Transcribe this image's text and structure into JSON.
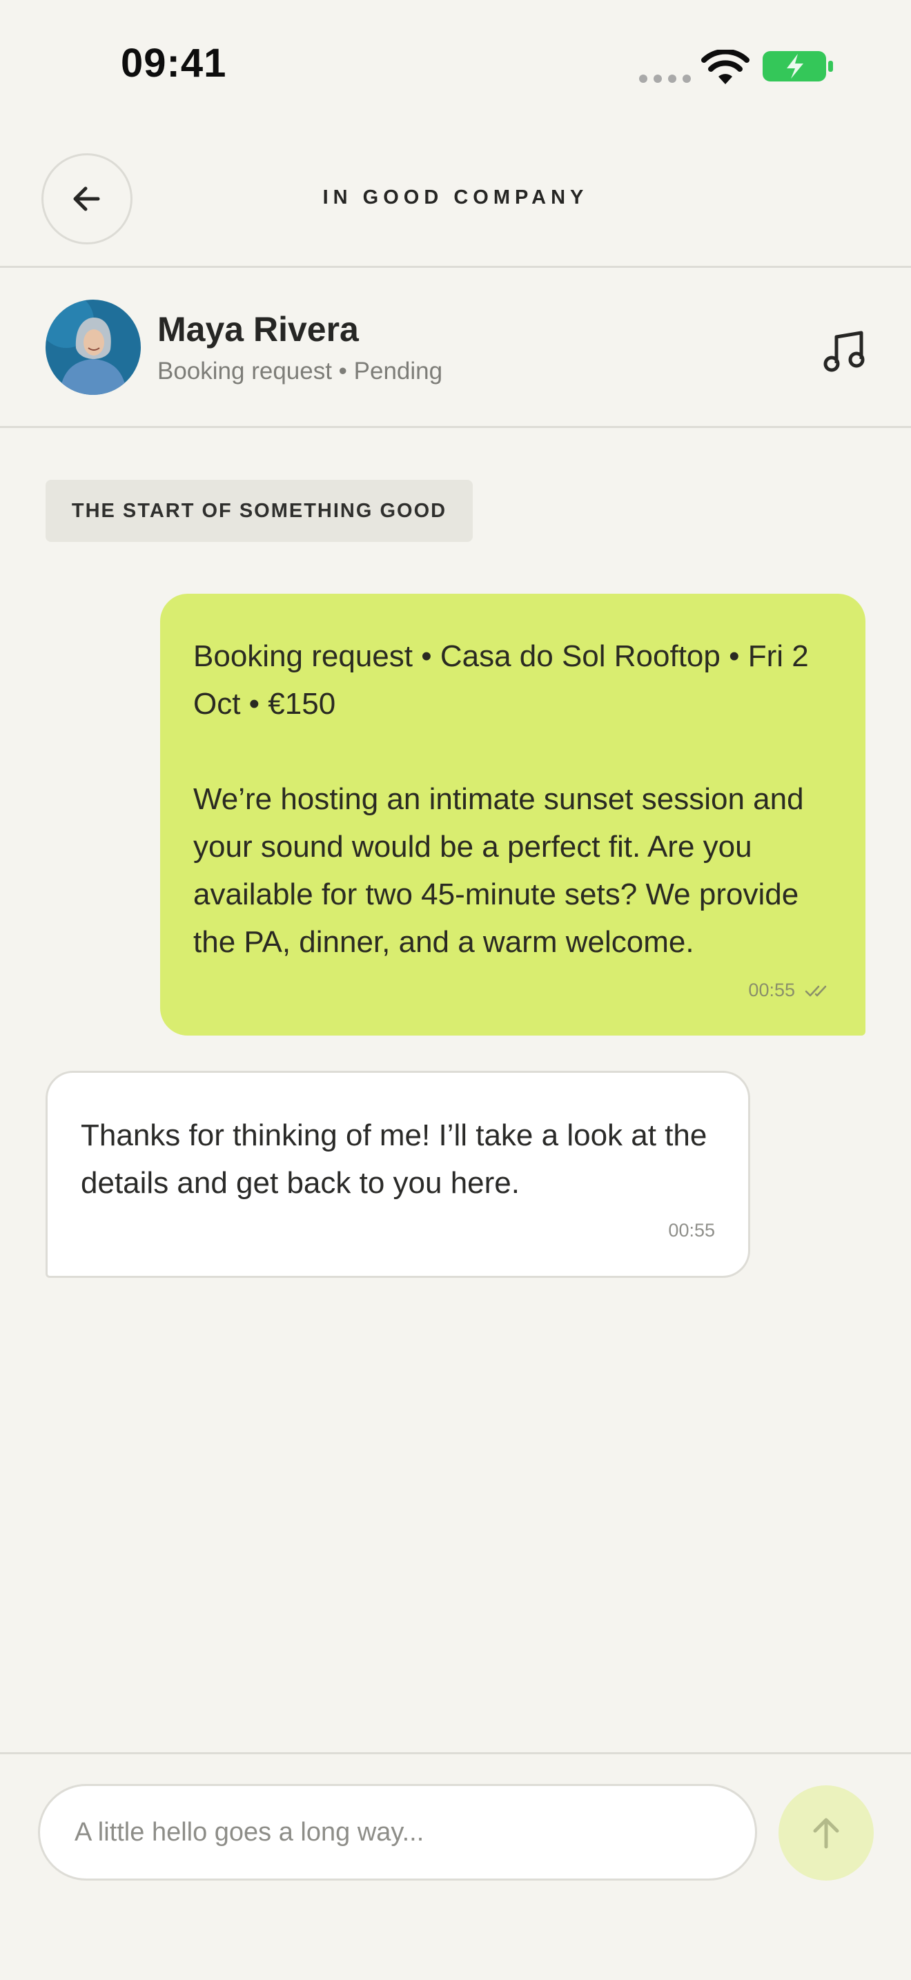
{
  "status_bar": {
    "time": "09:41",
    "battery_color": "#34c759",
    "icons": [
      "cellular-dots-icon",
      "wifi-icon",
      "battery-charging-icon"
    ]
  },
  "header": {
    "title": "IN GOOD COMPANY",
    "back_icon": "arrow-left-icon"
  },
  "contact": {
    "name": "Maya Rivera",
    "status": "Booking request • Pending",
    "action_icon": "music-note-icon"
  },
  "chat": {
    "day_chip": "THE START OF SOMETHING GOOD",
    "messages": [
      {
        "direction": "outgoing",
        "text": "Booking request • Casa do Sol Rooftop • Fri 2 Oct • €150\n\nWe’re hosting an intimate sunset session and your sound would be a perfect fit. Are you available for two 45-minute sets? We provide the PA, dinner, and a warm welcome.",
        "time": "00:55",
        "read_icon": "double-check-icon",
        "bubble_color": "#d9ed70"
      },
      {
        "direction": "incoming",
        "text": "Thanks for thinking of me! I’ll take a look at the details and get back to you here.",
        "time": "00:55",
        "bubble_color": "#ffffff"
      }
    ]
  },
  "composer": {
    "placeholder": "A little hello goes a long way...",
    "value": "",
    "send_icon": "arrow-up-icon",
    "send_color": "#ebf2bd"
  }
}
